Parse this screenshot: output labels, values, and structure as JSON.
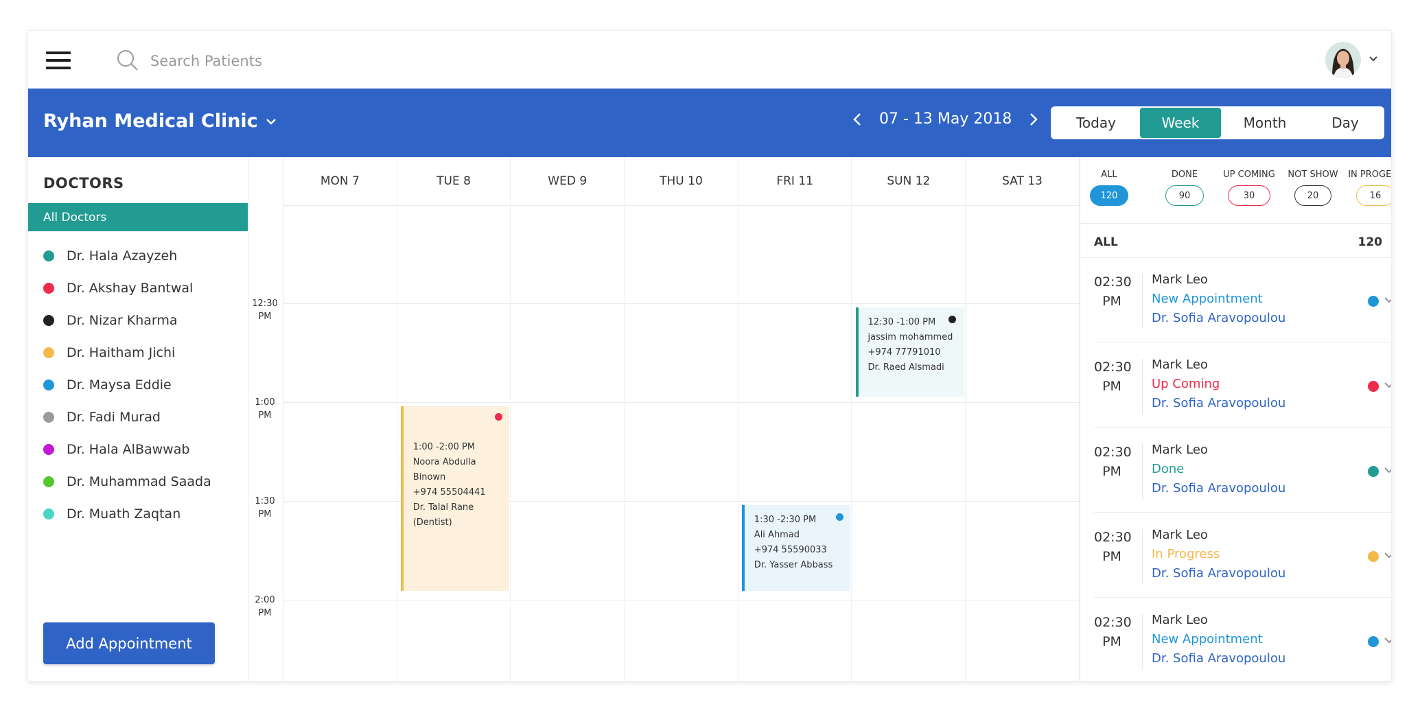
{
  "search": {
    "placeholder": "Search Patients"
  },
  "header": {
    "clinic_name": "Ryhan Medical Clinic",
    "date_range": "07 - 13 May 2018",
    "views": [
      "Today",
      "Week",
      "Month",
      "Day"
    ],
    "active_view": "Week",
    "color": "#2f64c6"
  },
  "doctors_panel": {
    "title": "DOCTORS",
    "all_label": "All Doctors",
    "items": [
      {
        "name": "Dr. Hala Azayzeh",
        "color": "#229c93"
      },
      {
        "name": "Dr. Akshay Bantwal",
        "color": "#ef2a4a"
      },
      {
        "name": "Dr. Nizar Kharma",
        "color": "#222222"
      },
      {
        "name": "Dr. Haitham Jichi",
        "color": "#f3b94b"
      },
      {
        "name": "Dr. Maysa Eddie",
        "color": "#2096d8"
      },
      {
        "name": "Dr. Fadi Murad",
        "color": "#9a9a9a"
      },
      {
        "name": "Dr. Hala AlBawwab",
        "color": "#c419d6"
      },
      {
        "name": "Dr. Muhammad Saada",
        "color": "#55c72e"
      },
      {
        "name": "Dr. Muath Zaqtan",
        "color": "#46d6c3"
      }
    ],
    "add_button": "Add Appointment"
  },
  "calendar": {
    "days": [
      "MON 7",
      "TUE 8",
      "WED 9",
      "THU 10",
      "FRI 11",
      "SUN 12",
      "SAT 13"
    ],
    "times": [
      [
        "12:30",
        "PM"
      ],
      [
        "1:00",
        "PM"
      ],
      [
        "1:30",
        "PM"
      ],
      [
        "2:00",
        "PM"
      ]
    ],
    "appointments": [
      {
        "day": 5,
        "slot": "12:30 - 1:00",
        "lines": [
          "12:30 -1:00 PM",
          "jassim mohammed",
          "+974 77791010",
          "Dr. Raed Alsmadi"
        ],
        "accent": "#229c93",
        "bg": "#eef8f8",
        "marker": "#222222"
      },
      {
        "day": 1,
        "slot": "1:00 - 2:00",
        "lines": [
          "1:00 -2:00 PM",
          "Noora Abdulla",
          "Binown",
          "+974 55504441",
          "Dr. Talal Rane",
          "(Dentist)"
        ],
        "accent": "#f3b94b",
        "bg": "#fdf1de",
        "marker": "#ef2a4a"
      },
      {
        "day": 4,
        "slot": "1:30 - 2:00",
        "lines": [
          "1:30 -2:30 PM",
          "Ali Ahmad",
          "+974 55590033",
          "Dr. Yasser Abbass"
        ],
        "accent": "#2096d8",
        "bg": "#eaf5fb",
        "marker": "#2096d8"
      }
    ]
  },
  "summary": {
    "filters": [
      {
        "label": "ALL",
        "count": "120",
        "color": "#2096d8",
        "filled": true
      },
      {
        "label": "DONE",
        "count": "90",
        "color": "#229c93",
        "filled": false
      },
      {
        "label": "UP COMING",
        "count": "30",
        "color": "#ef2a4a",
        "filled": false
      },
      {
        "label": "NOT SHOW",
        "count": "20",
        "color": "#333333",
        "filled": false
      },
      {
        "label": "IN PROGESS",
        "count": "16",
        "color": "#f3b94b",
        "filled": false
      }
    ],
    "all_label": "ALL",
    "all_count": "120",
    "entries": [
      {
        "time": "02:30",
        "ampm": "PM",
        "name": "Mark Leo",
        "status": "New Appointment",
        "status_color": "#2096d8",
        "doctor": "Dr. Sofia Aravopoulou",
        "dot": "#2096d8"
      },
      {
        "time": "02:30",
        "ampm": "PM",
        "name": "Mark Leo",
        "status": "Up Coming",
        "status_color": "#ef2a4a",
        "doctor": "Dr. Sofia Aravopoulou",
        "dot": "#ef2a4a"
      },
      {
        "time": "02:30",
        "ampm": "PM",
        "name": "Mark Leo",
        "status": "Done",
        "status_color": "#229c93",
        "doctor": "Dr. Sofia Aravopoulou",
        "dot": "#229c93"
      },
      {
        "time": "02:30",
        "ampm": "PM",
        "name": "Mark Leo",
        "status": "In Progress",
        "status_color": "#f3b94b",
        "doctor": "Dr. Sofia Aravopoulou",
        "dot": "#f3b94b"
      },
      {
        "time": "02:30",
        "ampm": "PM",
        "name": "Mark Leo",
        "status": "New Appointment",
        "status_color": "#2096d8",
        "doctor": "Dr. Sofia Aravopoulou",
        "dot": "#2096d8"
      }
    ]
  }
}
